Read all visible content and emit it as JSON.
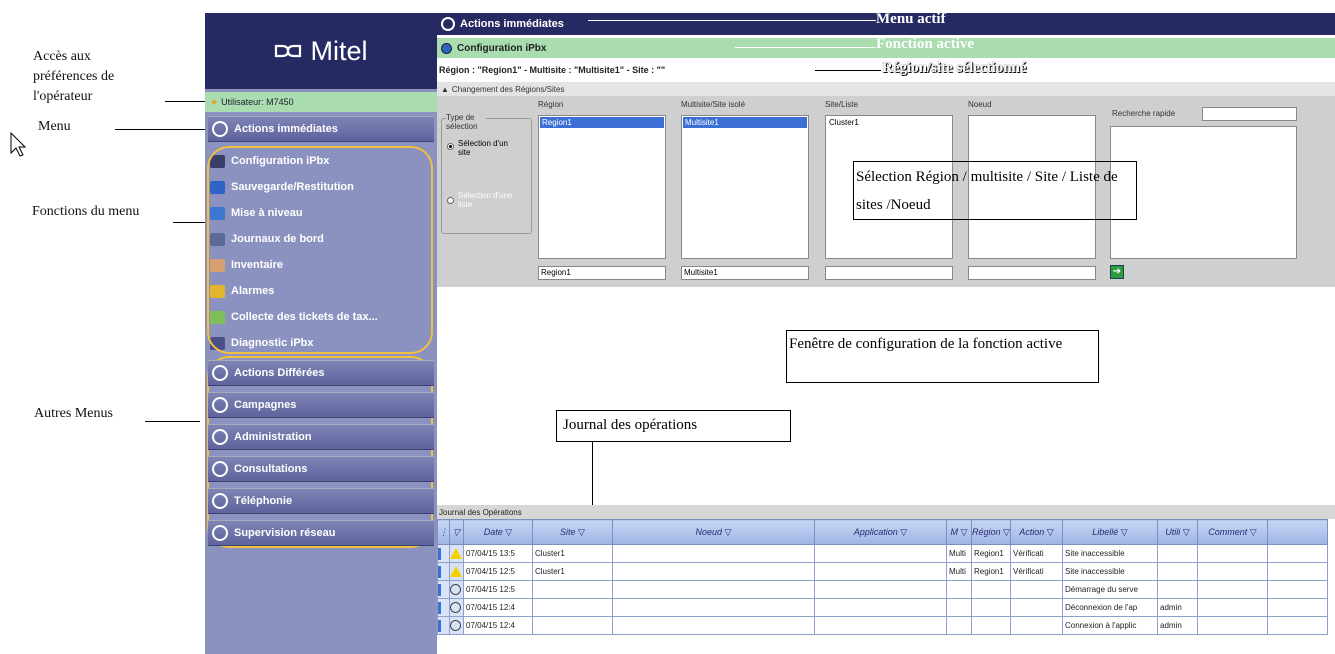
{
  "annotations": {
    "preferences": "Accès aux préférences de l'opérateur",
    "menu": "Menu",
    "functions": "Fonctions du menu",
    "other_menus": "Autres Menus",
    "active_menu": "Menu actif",
    "active_function": "Fonction active",
    "selected_site": "Région/site sélectionné",
    "selection_box": "Sélection Région / multisite / Site / Liste de sites /Noeud",
    "config_window": "Fenêtre de configuration de la fonction active",
    "journal": "Journal des opérations"
  },
  "sidebar": {
    "logo": "Mitel",
    "user": "Utilisateur: M7450",
    "active_menu": "Actions immédiates",
    "functions": [
      {
        "label": "Configuration iPbx",
        "icon": "gear-icon",
        "color": "#3a3f6a"
      },
      {
        "label": "Sauvegarde/Restitution",
        "icon": "save-icon",
        "color": "#2f64c4"
      },
      {
        "label": "Mise à niveau",
        "icon": "upgrade-icon",
        "color": "#3d78d0"
      },
      {
        "label": "Journaux de bord",
        "icon": "log-icon",
        "color": "#5c6a9a"
      },
      {
        "label": "Inventaire",
        "icon": "inventory-icon",
        "color": "#d8a070"
      },
      {
        "label": "Alarmes",
        "icon": "alarm-icon",
        "color": "#e3b52e"
      },
      {
        "label": "Collecte des tickets de tax...",
        "icon": "tickets-icon",
        "color": "#7fbf5a"
      },
      {
        "label": "Diagnostic iPbx",
        "icon": "diagnostic-icon",
        "color": "#4b5089"
      }
    ],
    "other_menus": [
      {
        "label": "Actions Différées",
        "icon": "clock-icon"
      },
      {
        "label": "Campagnes",
        "icon": "campaign-icon"
      },
      {
        "label": "Administration",
        "icon": "admin-icon"
      },
      {
        "label": "Consultations",
        "icon": "book-icon"
      },
      {
        "label": "Téléphonie",
        "icon": "phone-icon"
      },
      {
        "label": "Supervision réseau",
        "icon": "network-icon"
      }
    ]
  },
  "main": {
    "topbar": "Actions immédiates",
    "function": "Configuration iPbx",
    "region_line": "Région : \"Region1\" - Multisite : \"Multisite1\" - Site : \"\"",
    "change_label": "Changement des Régions/Sites",
    "type_label": "Type de sélection",
    "radio_site": "Sélection d'un site",
    "radio_list": "Sélection d'une liste",
    "columns": {
      "region": "Région",
      "multisite": "Multisite/Site isolé",
      "site": "Site/Liste",
      "node": "Noeud",
      "quick": "Recherche rapide"
    },
    "lists": {
      "region": "Region1",
      "multisite": "Multisite1",
      "site": "Cluster1"
    },
    "inputs": {
      "region": "Region1",
      "multisite": "Multisite1"
    }
  },
  "journal": {
    "title": "Journal des Opérations",
    "headers": [
      "Date",
      "Site",
      "Noeud",
      "Application",
      "M",
      "Région",
      "Action",
      "Libellé",
      "Utili",
      "Comment"
    ],
    "rows": [
      {
        "type": "warning",
        "cells": [
          "07/04/15 13:5",
          "Cluster1",
          "",
          "",
          "Multi",
          "Region1",
          "Vérificati",
          "Site inaccessible",
          "",
          ""
        ]
      },
      {
        "type": "warning",
        "cells": [
          "07/04/15 12:5",
          "Cluster1",
          "",
          "",
          "Multi",
          "Region1",
          "Vérificati",
          "Site inaccessible",
          "",
          ""
        ]
      },
      {
        "type": "info",
        "cells": [
          "07/04/15 12:5",
          "",
          "",
          "",
          "",
          "",
          "",
          "Démarrage du serve",
          "",
          ""
        ]
      },
      {
        "type": "info",
        "cells": [
          "07/04/15 12:4",
          "",
          "",
          "",
          "",
          "",
          "",
          "Déconnexion de l'ap",
          "admin",
          ""
        ]
      },
      {
        "type": "info",
        "cells": [
          "07/04/15 12:4",
          "",
          "",
          "",
          "",
          "",
          "",
          "Connexion à l'applic",
          "admin",
          ""
        ]
      }
    ]
  }
}
